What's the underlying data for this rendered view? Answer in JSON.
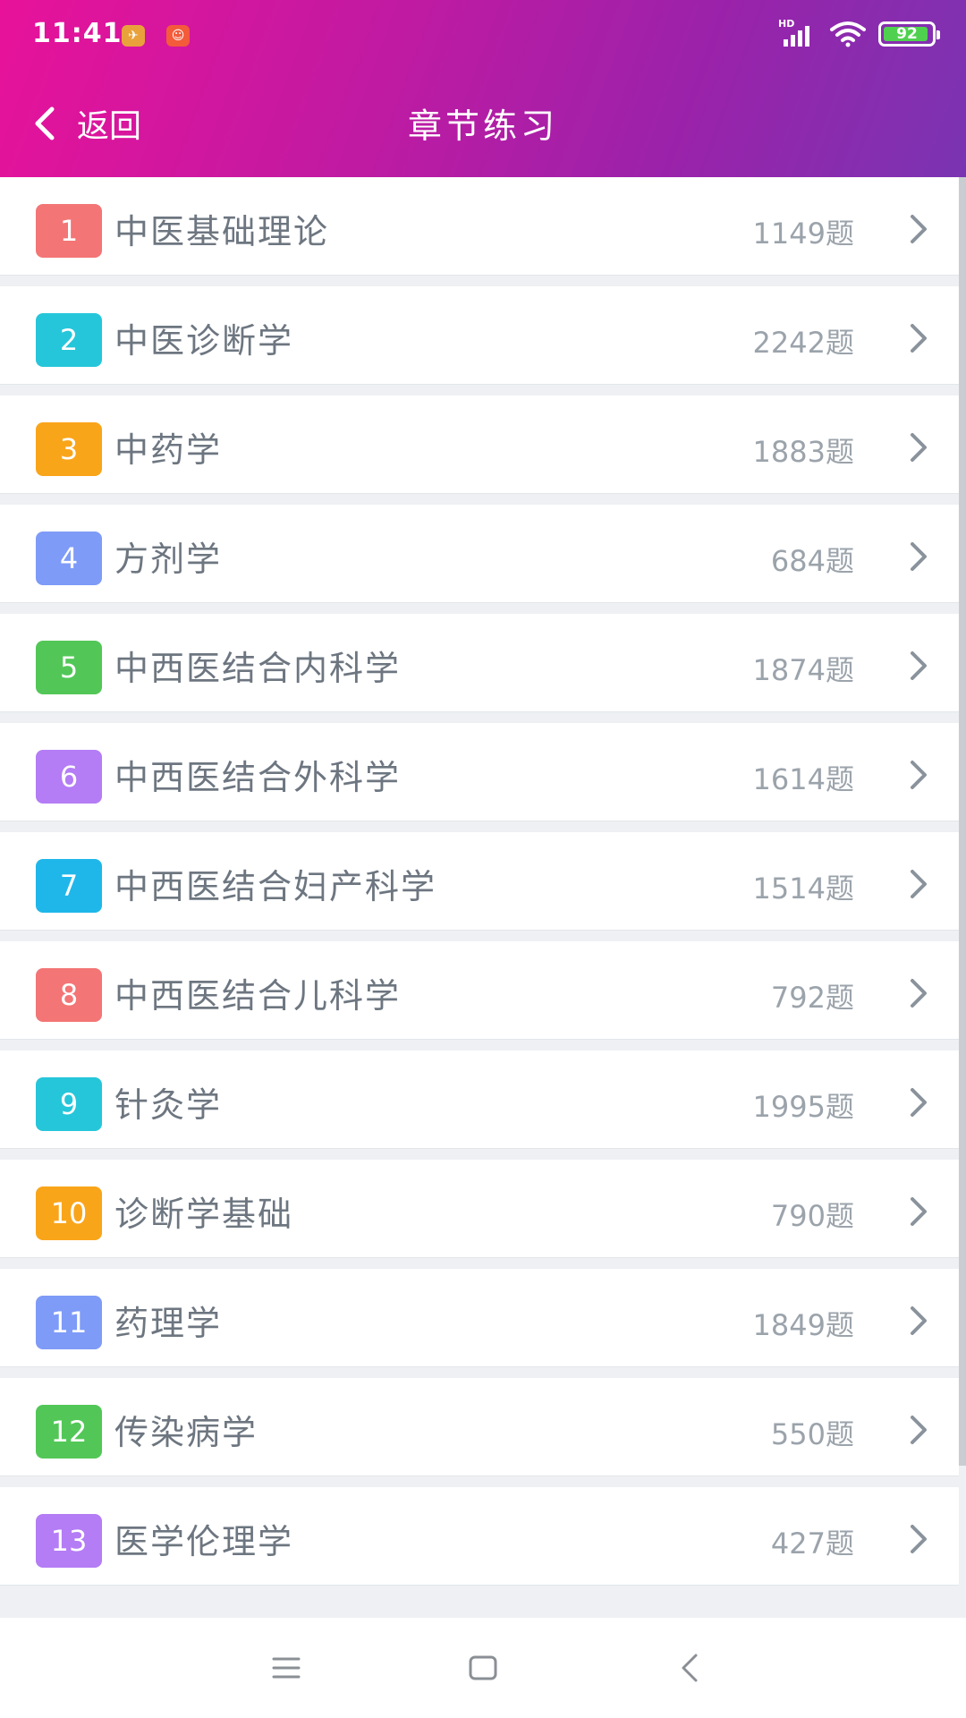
{
  "status_bar": {
    "time": "11:41",
    "battery": "92",
    "network": "HD"
  },
  "header": {
    "back_label": "返回",
    "title": "章节练习"
  },
  "chapters": [
    {
      "num": "1",
      "title": "中医基础理论",
      "count": "1149题",
      "color": "#f37575"
    },
    {
      "num": "2",
      "title": "中医诊断学",
      "count": "2242题",
      "color": "#26c6da"
    },
    {
      "num": "3",
      "title": "中药学",
      "count": "1883题",
      "color": "#f9a51a"
    },
    {
      "num": "4",
      "title": "方剂学",
      "count": "684题",
      "color": "#7e9bf7"
    },
    {
      "num": "5",
      "title": "中西医结合内科学",
      "count": "1874题",
      "color": "#52c757"
    },
    {
      "num": "6",
      "title": "中西医结合外科学",
      "count": "1614题",
      "color": "#b47cf5"
    },
    {
      "num": "7",
      "title": "中西医结合妇产科学",
      "count": "1514题",
      "color": "#1fb7ea"
    },
    {
      "num": "8",
      "title": "中西医结合儿科学",
      "count": "792题",
      "color": "#f37575"
    },
    {
      "num": "9",
      "title": "针灸学",
      "count": "1995题",
      "color": "#26c6da"
    },
    {
      "num": "10",
      "title": "诊断学基础",
      "count": "790题",
      "color": "#f9a51a"
    },
    {
      "num": "11",
      "title": "药理学",
      "count": "1849题",
      "color": "#7e9bf7"
    },
    {
      "num": "12",
      "title": "传染病学",
      "count": "550题",
      "color": "#52c757"
    },
    {
      "num": "13",
      "title": "医学伦理学",
      "count": "427题",
      "color": "#b47cf5"
    }
  ]
}
